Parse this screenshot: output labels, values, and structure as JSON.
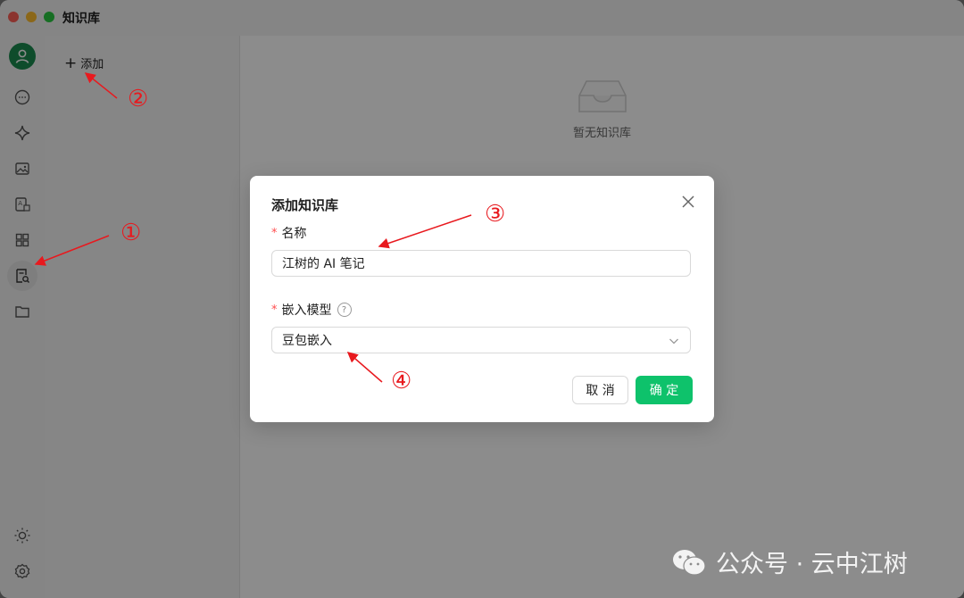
{
  "window": {
    "title": "知识库"
  },
  "rail": {
    "items": [
      {
        "name": "chat-icon"
      },
      {
        "name": "sparkle-icon"
      },
      {
        "name": "image-icon"
      },
      {
        "name": "translate-icon"
      },
      {
        "name": "apps-grid-icon"
      },
      {
        "name": "knowledge-base-icon"
      },
      {
        "name": "folder-icon"
      }
    ],
    "bottom": [
      {
        "name": "sun-icon"
      },
      {
        "name": "settings-icon"
      }
    ]
  },
  "left_panel": {
    "add_label": "添加"
  },
  "main": {
    "empty_text": "暂无知识库"
  },
  "dialog": {
    "title": "添加知识库",
    "name_label": "名称",
    "name_value": "江树的 AI 笔记",
    "model_label": "嵌入模型",
    "model_value": "豆包嵌入",
    "help_glyph": "?",
    "cancel_label": "取 消",
    "confirm_label": "确 定"
  },
  "annotations": [
    "①",
    "②",
    "③",
    "④"
  ],
  "watermark": {
    "text": "公众号 · 云中江树"
  },
  "colors": {
    "accent": "#0ec26b",
    "annotation": "#e8191e",
    "required": "#ff4d4f"
  }
}
